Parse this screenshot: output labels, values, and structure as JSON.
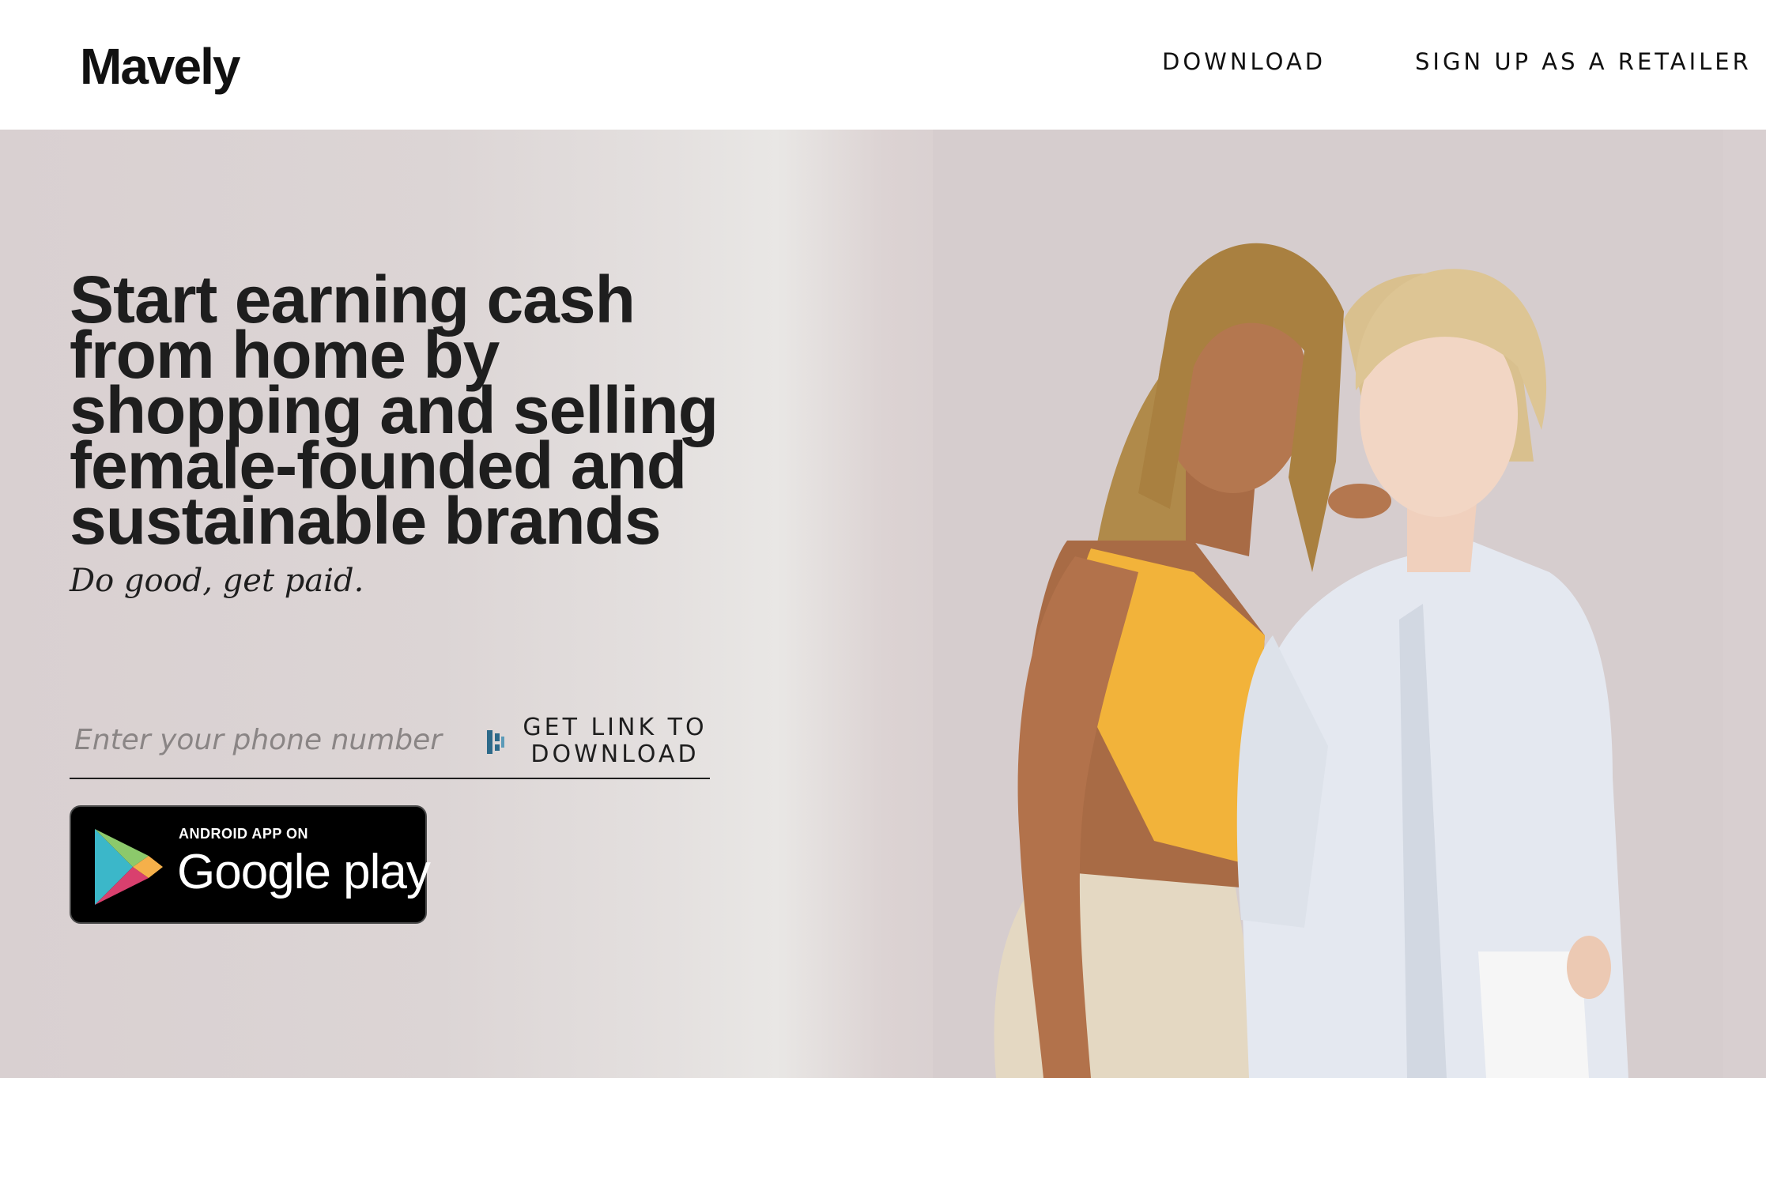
{
  "header": {
    "logo": "Mavely",
    "nav": {
      "download": "DOWNLOAD",
      "retailer": "SIGN UP AS A RETAILER"
    }
  },
  "hero": {
    "headline": "Start earning cash from home by shopping and selling female-founded and sustainable brands",
    "tagline": "Do good, get paid.",
    "phone_placeholder": "Enter your phone number",
    "get_link_label": "GET LINK TO DOWNLOAD",
    "badge": {
      "small": "ANDROID APP ON",
      "big": "Google play"
    }
  },
  "colors": {
    "text": "#1e1e1e",
    "hero_bg": "#d9d0d1",
    "badge_bg": "#000000"
  },
  "icons": [
    "flag-icon",
    "google-play-triangle-icon"
  ]
}
